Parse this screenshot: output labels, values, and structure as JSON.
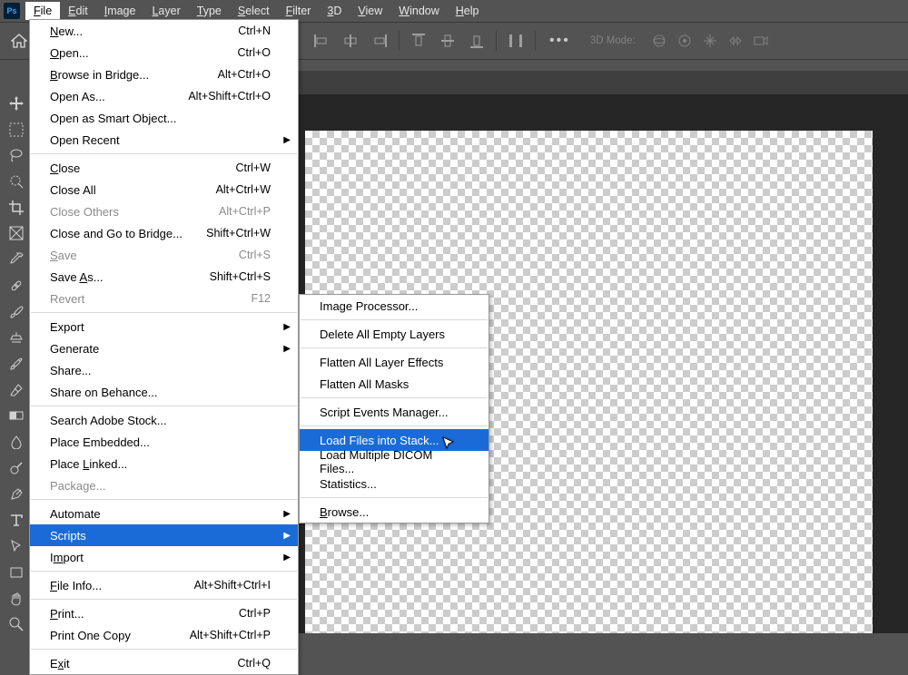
{
  "logo": "Ps",
  "menubar": [
    "File",
    "Edit",
    "Image",
    "Layer",
    "Type",
    "Select",
    "Filter",
    "3D",
    "View",
    "Window",
    "Help"
  ],
  "opt": {
    "mode3d": "3D Mode:"
  },
  "file_menu": [
    {
      "type": "item",
      "label": "New...",
      "u": 0,
      "shortcut": "Ctrl+N"
    },
    {
      "type": "item",
      "label": "Open...",
      "u": 0,
      "shortcut": "Ctrl+O"
    },
    {
      "type": "item",
      "label": "Browse in Bridge...",
      "u": 0,
      "shortcut": "Alt+Ctrl+O"
    },
    {
      "type": "item",
      "label": "Open As...",
      "u": -1,
      "shortcut": "Alt+Shift+Ctrl+O"
    },
    {
      "type": "item",
      "label": "Open as Smart Object...",
      "u": -1,
      "shortcut": ""
    },
    {
      "type": "item",
      "label": "Open Recent",
      "u": -1,
      "shortcut": "",
      "arrow": true
    },
    {
      "type": "sep"
    },
    {
      "type": "item",
      "label": "Close",
      "u": 0,
      "shortcut": "Ctrl+W"
    },
    {
      "type": "item",
      "label": "Close All",
      "u": -1,
      "shortcut": "Alt+Ctrl+W"
    },
    {
      "type": "item",
      "label": "Close Others",
      "u": -1,
      "shortcut": "Alt+Ctrl+P",
      "disabled": true
    },
    {
      "type": "item",
      "label": "Close and Go to Bridge...",
      "u": -1,
      "shortcut": "Shift+Ctrl+W"
    },
    {
      "type": "item",
      "label": "Save",
      "u": 0,
      "shortcut": "Ctrl+S",
      "disabled": true
    },
    {
      "type": "item",
      "label": "Save As...",
      "u": 5,
      "shortcut": "Shift+Ctrl+S"
    },
    {
      "type": "item",
      "label": "Revert",
      "u": -1,
      "shortcut": "F12",
      "disabled": true
    },
    {
      "type": "sep"
    },
    {
      "type": "item",
      "label": "Export",
      "u": -1,
      "shortcut": "",
      "arrow": true
    },
    {
      "type": "item",
      "label": "Generate",
      "u": -1,
      "shortcut": "",
      "arrow": true
    },
    {
      "type": "item",
      "label": "Share...",
      "u": -1,
      "shortcut": ""
    },
    {
      "type": "item",
      "label": "Share on Behance...",
      "u": -1,
      "shortcut": ""
    },
    {
      "type": "sep"
    },
    {
      "type": "item",
      "label": "Search Adobe Stock...",
      "u": -1,
      "shortcut": ""
    },
    {
      "type": "item",
      "label": "Place Embedded...",
      "u": -1,
      "shortcut": ""
    },
    {
      "type": "item",
      "label": "Place Linked...",
      "u": 6,
      "shortcut": ""
    },
    {
      "type": "item",
      "label": "Package...",
      "u": -1,
      "shortcut": "",
      "disabled": true
    },
    {
      "type": "sep"
    },
    {
      "type": "item",
      "label": "Automate",
      "u": -1,
      "shortcut": "",
      "arrow": true
    },
    {
      "type": "item",
      "label": "Scripts",
      "u": -1,
      "shortcut": "",
      "arrow": true,
      "highlight": true
    },
    {
      "type": "item",
      "label": "Import",
      "u": 1,
      "shortcut": "",
      "arrow": true
    },
    {
      "type": "sep"
    },
    {
      "type": "item",
      "label": "File Info...",
      "u": 0,
      "shortcut": "Alt+Shift+Ctrl+I"
    },
    {
      "type": "sep"
    },
    {
      "type": "item",
      "label": "Print...",
      "u": 0,
      "shortcut": "Ctrl+P"
    },
    {
      "type": "item",
      "label": "Print One Copy",
      "u": -1,
      "shortcut": "Alt+Shift+Ctrl+P"
    },
    {
      "type": "sep"
    },
    {
      "type": "item",
      "label": "Exit",
      "u": 1,
      "shortcut": "Ctrl+Q"
    }
  ],
  "scripts_menu": [
    {
      "type": "item",
      "label": "Image Processor...",
      "u": -1
    },
    {
      "type": "sep"
    },
    {
      "type": "item",
      "label": "Delete All Empty Layers",
      "u": -1
    },
    {
      "type": "sep"
    },
    {
      "type": "item",
      "label": "Flatten All Layer Effects",
      "u": -1
    },
    {
      "type": "item",
      "label": "Flatten All Masks",
      "u": -1
    },
    {
      "type": "sep"
    },
    {
      "type": "item",
      "label": "Script Events Manager...",
      "u": -1
    },
    {
      "type": "sep"
    },
    {
      "type": "item",
      "label": "Load Files into Stack...",
      "u": -1,
      "highlight": true
    },
    {
      "type": "item",
      "label": "Load Multiple DICOM Files...",
      "u": -1
    },
    {
      "type": "item",
      "label": "Statistics...",
      "u": -1
    },
    {
      "type": "sep"
    },
    {
      "type": "item",
      "label": "Browse...",
      "u": 0
    }
  ],
  "tools": [
    "move",
    "marquee",
    "lasso",
    "wand",
    "crop",
    "frame",
    "eyedropper",
    "healing",
    "brush",
    "clone",
    "history",
    "eraser",
    "gradient",
    "blur",
    "dodge",
    "pen",
    "type",
    "path",
    "rectangle",
    "hand",
    "zoom"
  ]
}
